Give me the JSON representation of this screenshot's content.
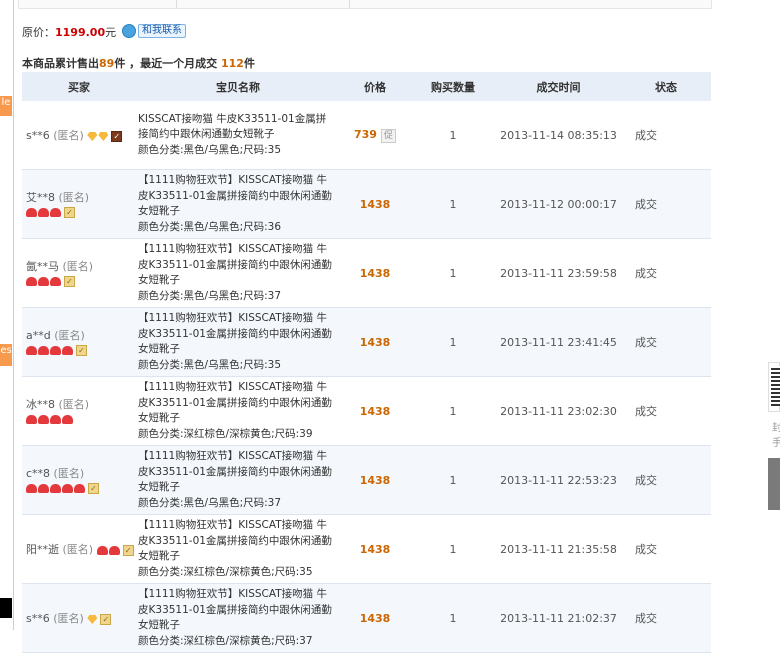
{
  "side": {
    "left_tab_top": "le",
    "left_tab_bottom": "es",
    "right_text_1": "封",
    "right_text_2": "手"
  },
  "summary": {
    "price_label": "原价：",
    "price_value": "1199.00",
    "price_unit": "元",
    "contact_label": "和我联系",
    "stats_prefix": "本商品累计售出",
    "stats_total": "89",
    "stats_mid": "件 ，最近一个月成交",
    "stats_month": "112",
    "stats_suffix": "件"
  },
  "table": {
    "headers": [
      "买家",
      "宝贝名称",
      "价格",
      "购买数量",
      "成交时间",
      "状态"
    ],
    "rows": [
      {
        "buyer": "s**6",
        "anon": "(匿名)",
        "badge": "diamond",
        "badge_count": 2,
        "vip": "dark",
        "title_1": "KISSCAT接吻猫 牛皮K33511-01金属拼",
        "title_2": "接简约中跟休闲通勤女短靴子",
        "title_3": "",
        "spec": "颜色分类:黑色/乌黑色;尺码:35",
        "price": "739",
        "promo": "促",
        "qty": "1",
        "time": "2013-11-14 08:35:13",
        "status": "成交"
      },
      {
        "buyer": "艾**8",
        "anon": "(匿名)",
        "badge": "heart",
        "badge_count": 3,
        "vip": "light",
        "title_1": "【1111购物狂欢节】KISSCAT接吻猫 牛",
        "title_2": "皮K33511-01金属拼接简约中跟休闲通勤",
        "title_3": "女短靴子",
        "spec": "颜色分类:黑色/乌黑色;尺码:36",
        "price": "1438",
        "promo": "",
        "qty": "1",
        "time": "2013-11-12 00:00:17",
        "status": "成交"
      },
      {
        "buyer": "氤**马",
        "anon": "(匿名)",
        "badge": "heart",
        "badge_count": 3,
        "vip": "light",
        "title_1": "【1111购物狂欢节】KISSCAT接吻猫 牛",
        "title_2": "皮K33511-01金属拼接简约中跟休闲通勤",
        "title_3": "女短靴子",
        "spec": "颜色分类:黑色/乌黑色;尺码:37",
        "price": "1438",
        "promo": "",
        "qty": "1",
        "time": "2013-11-11 23:59:58",
        "status": "成交"
      },
      {
        "buyer": "a**d",
        "anon": "(匿名)",
        "badge": "heart",
        "badge_count": 4,
        "vip": "light",
        "title_1": "【1111购物狂欢节】KISSCAT接吻猫 牛",
        "title_2": "皮K33511-01金属拼接简约中跟休闲通勤",
        "title_3": "女短靴子",
        "spec": "颜色分类:黑色/乌黑色;尺码:35",
        "price": "1438",
        "promo": "",
        "qty": "1",
        "time": "2013-11-11 23:41:45",
        "status": "成交"
      },
      {
        "buyer": "冰**8",
        "anon": "(匿名)",
        "badge": "heart",
        "badge_count": 4,
        "vip": "",
        "title_1": "【1111购物狂欢节】KISSCAT接吻猫 牛",
        "title_2": "皮K33511-01金属拼接简约中跟休闲通勤",
        "title_3": "女短靴子",
        "spec": "颜色分类:深红棕色/深棕黄色;尺码:39",
        "price": "1438",
        "promo": "",
        "qty": "1",
        "time": "2013-11-11 23:02:30",
        "status": "成交"
      },
      {
        "buyer": "c**8",
        "anon": "(匿名)",
        "badge": "heart",
        "badge_count": 5,
        "vip": "light",
        "title_1": "【1111购物狂欢节】KISSCAT接吻猫 牛",
        "title_2": "皮K33511-01金属拼接简约中跟休闲通勤",
        "title_3": "女短靴子",
        "spec": "颜色分类:黑色/乌黑色;尺码:37",
        "price": "1438",
        "promo": "",
        "qty": "1",
        "time": "2013-11-11 22:53:23",
        "status": "成交"
      },
      {
        "buyer": "阳**逝",
        "anon": "(匿名)",
        "badge": "heart",
        "badge_count": 2,
        "vip": "light",
        "title_1": "【1111购物狂欢节】KISSCAT接吻猫 牛",
        "title_2": "皮K33511-01金属拼接简约中跟休闲通勤",
        "title_3": "女短靴子",
        "spec": "颜色分类:深红棕色/深棕黄色;尺码:35",
        "price": "1438",
        "promo": "",
        "qty": "1",
        "time": "2013-11-11 21:35:58",
        "status": "成交"
      },
      {
        "buyer": "s**6",
        "anon": "(匿名)",
        "badge": "diamond",
        "badge_count": 1,
        "vip": "light",
        "title_1": "【1111购物狂欢节】KISSCAT接吻猫 牛",
        "title_2": "皮K33511-01金属拼接简约中跟休闲通勤",
        "title_3": "女短靴子",
        "spec": "颜色分类:深红棕色/深棕黄色;尺码:37",
        "price": "1438",
        "promo": "",
        "qty": "1",
        "time": "2013-11-11 21:02:37",
        "status": "成交"
      }
    ]
  }
}
